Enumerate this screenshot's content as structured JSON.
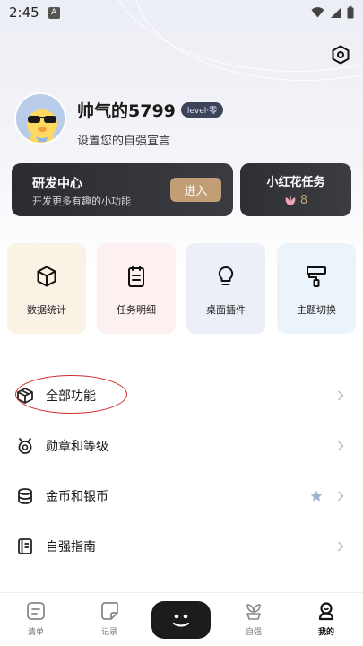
{
  "status": {
    "time": "2:45",
    "notif_letter": "A"
  },
  "profile": {
    "username": "帅气的5799",
    "level": "level·零",
    "motto": "设置您的自强宣言"
  },
  "dev_center": {
    "title": "研发中心",
    "subtitle": "开发更多有趣的小功能",
    "enter_label": "进入"
  },
  "task": {
    "title": "小红花任务",
    "count": "8"
  },
  "tools": [
    {
      "label": "数据统计",
      "icon": "cube-icon",
      "bg": "#fbf2e6"
    },
    {
      "label": "任务明细",
      "icon": "clipboard-icon",
      "bg": "#fcf0f0"
    },
    {
      "label": "桌面插件",
      "icon": "lightbulb-icon",
      "bg": "#eceef8"
    },
    {
      "label": "主题切换",
      "icon": "paint-roller-icon",
      "bg": "#ecf4fb"
    }
  ],
  "menu": [
    {
      "label": "全部功能",
      "icon": "box-icon"
    },
    {
      "label": "勋章和等级",
      "icon": "medal-icon"
    },
    {
      "label": "金币和银币",
      "icon": "coins-icon"
    },
    {
      "label": "自强指南",
      "icon": "guide-book-icon"
    }
  ],
  "nav": [
    {
      "label": "清单",
      "icon": "list-icon"
    },
    {
      "label": "记录",
      "icon": "note-icon"
    },
    {
      "label": "",
      "icon": "face-icon"
    },
    {
      "label": "自强",
      "icon": "sprout-icon"
    },
    {
      "label": "我的",
      "icon": "profile-icon"
    }
  ],
  "colors": {
    "accent_gold": "#c29e76",
    "dark_card": "#2b2c31",
    "annotation_red": "#d02b2b"
  }
}
